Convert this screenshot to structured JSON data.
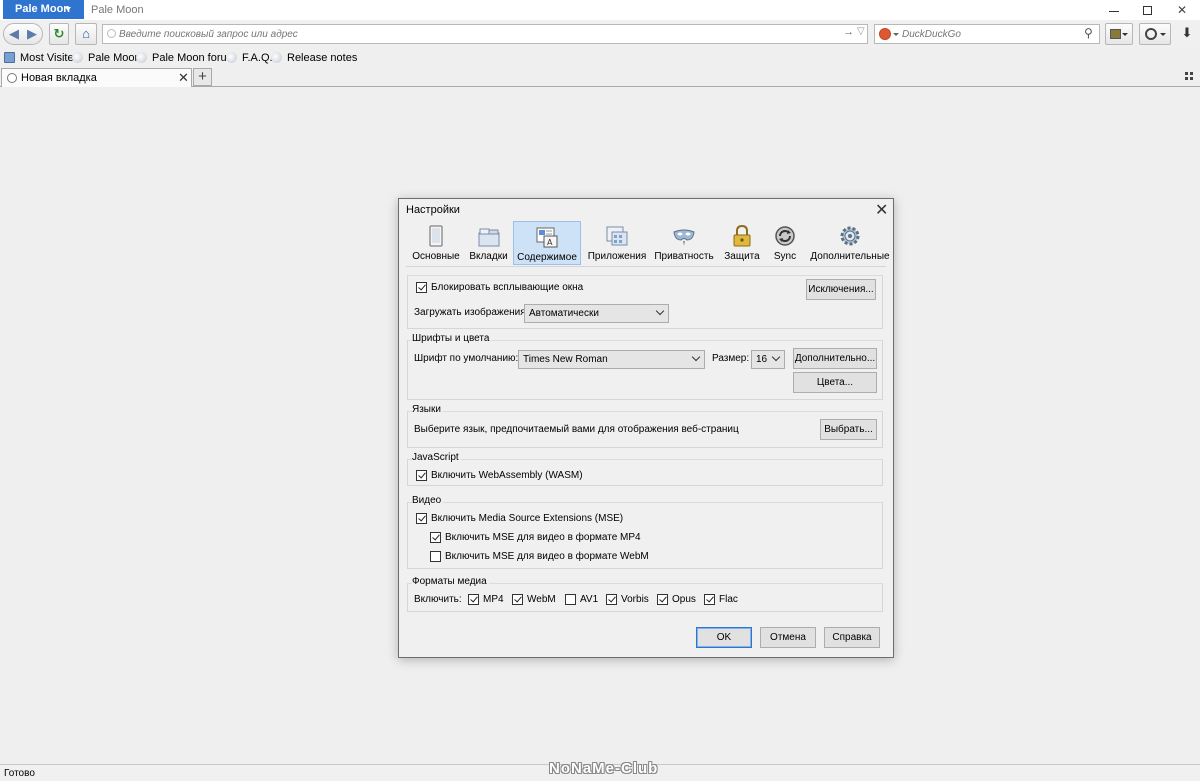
{
  "titlebar": {
    "app_button": "Pale Moon",
    "window_title": "Pale Moon"
  },
  "navbar": {
    "url_placeholder": "Введите поисковый запрос или адрес",
    "search_placeholder": "DuckDuckGo",
    "search_engine_color": "#de5833"
  },
  "bookmarks": [
    {
      "label": "Most Visited",
      "icon": "most-visited-icon"
    },
    {
      "label": "Pale Moon",
      "icon": "pale-moon-icon"
    },
    {
      "label": "Pale Moon forum",
      "icon": "pale-moon-icon"
    },
    {
      "label": "F.A.Q.",
      "icon": "pale-moon-icon"
    },
    {
      "label": "Release notes",
      "icon": "pale-moon-icon"
    }
  ],
  "tabs": [
    {
      "label": "Новая вкладка",
      "active": true
    }
  ],
  "statusbar": {
    "text": "Готово",
    "watermark": "NoNaMe-Club"
  },
  "dialog": {
    "title": "Настройки",
    "panes": [
      {
        "label": "Основные",
        "icon": "general-icon",
        "selected": false
      },
      {
        "label": "Вкладки",
        "icon": "tabs-icon",
        "selected": false
      },
      {
        "label": "Содержимое",
        "icon": "content-icon",
        "selected": true
      },
      {
        "label": "Приложения",
        "icon": "applications-icon",
        "selected": false
      },
      {
        "label": "Приватность",
        "icon": "privacy-mask-icon",
        "selected": false
      },
      {
        "label": "Защита",
        "icon": "security-lock-icon",
        "selected": false
      },
      {
        "label": "Sync",
        "icon": "sync-icon",
        "selected": false
      },
      {
        "label": "Дополнительные",
        "icon": "advanced-gear-icon",
        "selected": false
      }
    ],
    "popups": {
      "block_label": "Блокировать всплывающие окна",
      "block_checked": true,
      "exceptions_button": "Исключения...",
      "load_images_label": "Загружать изображения:",
      "load_images_value": "Автоматически"
    },
    "fonts": {
      "caption": "Шрифты и цвета",
      "default_font_label": "Шрифт по умолчанию:",
      "default_font_value": "Times New Roman",
      "size_label": "Размер:",
      "size_value": "16",
      "advanced_button": "Дополнительно...",
      "colors_button": "Цвета..."
    },
    "languages": {
      "caption": "Языки",
      "description": "Выберите язык, предпочитаемый вами для отображения веб-страниц",
      "choose_button": "Выбрать..."
    },
    "javascript": {
      "caption": "JavaScript",
      "wasm_label": "Включить WebAssembly (WASM)",
      "wasm_checked": true
    },
    "video": {
      "caption": "Видео",
      "mse_label": "Включить Media Source Extensions (MSE)",
      "mse_checked": true,
      "mp4_label": "Включить MSE для видео в формате MP4",
      "mp4_checked": true,
      "webm_label": "Включить MSE для видео в формате WebM",
      "webm_checked": false
    },
    "media_formats": {
      "caption": "Форматы медиа",
      "enable_label": "Включить:",
      "formats": [
        {
          "label": "MP4",
          "checked": true
        },
        {
          "label": "WebM",
          "checked": true
        },
        {
          "label": "AV1",
          "checked": false
        },
        {
          "label": "Vorbis",
          "checked": true
        },
        {
          "label": "Opus",
          "checked": true
        },
        {
          "label": "Flac",
          "checked": true
        }
      ]
    },
    "buttons": {
      "ok": "OK",
      "cancel": "Отмена",
      "help": "Справка"
    }
  }
}
